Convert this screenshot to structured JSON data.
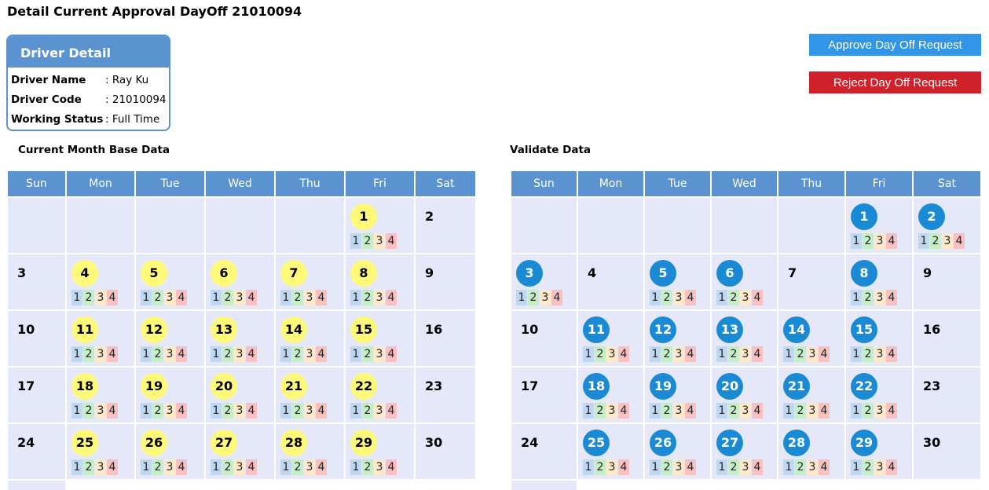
{
  "page": {
    "title": "Detail Current Approval DayOff 21010094"
  },
  "driver": {
    "header": "Driver Detail",
    "rows": [
      {
        "label": "Driver Name",
        "value": ": Ray Ku"
      },
      {
        "label": "Driver Code",
        "value": ": 21010094"
      },
      {
        "label": "Working Status",
        "value": ": Full Time"
      }
    ]
  },
  "actions": {
    "approve_label": "Approve Day Off Request",
    "reject_label": "Reject Day Off Request"
  },
  "colors": {
    "header_blue": "#5b93d0",
    "approve": "#3196e8",
    "reject": "#d0202a",
    "cell_bg": "#e4e8f8",
    "yellow_badge": "#fff97a",
    "blue_badge": "#1b8ad4"
  },
  "weekdays": [
    "Sun",
    "Mon",
    "Tue",
    "Wed",
    "Thu",
    "Fri",
    "Sat"
  ],
  "shift_labels": [
    "1",
    "2",
    "3",
    "4"
  ],
  "left_calendar": {
    "title": "Current Month Base Data",
    "highlight": "yellow",
    "weeks": [
      [
        null,
        null,
        null,
        null,
        null,
        {
          "d": "1",
          "h": true
        },
        {
          "d": "2",
          "h": false
        }
      ],
      [
        {
          "d": "3",
          "h": false
        },
        {
          "d": "4",
          "h": true
        },
        {
          "d": "5",
          "h": true
        },
        {
          "d": "6",
          "h": true
        },
        {
          "d": "7",
          "h": true
        },
        {
          "d": "8",
          "h": true
        },
        {
          "d": "9",
          "h": false
        }
      ],
      [
        {
          "d": "10",
          "h": false
        },
        {
          "d": "11",
          "h": true
        },
        {
          "d": "12",
          "h": true
        },
        {
          "d": "13",
          "h": true
        },
        {
          "d": "14",
          "h": true
        },
        {
          "d": "15",
          "h": true
        },
        {
          "d": "16",
          "h": false
        }
      ],
      [
        {
          "d": "17",
          "h": false
        },
        {
          "d": "18",
          "h": true
        },
        {
          "d": "19",
          "h": true
        },
        {
          "d": "20",
          "h": true
        },
        {
          "d": "21",
          "h": true
        },
        {
          "d": "22",
          "h": true
        },
        {
          "d": "23",
          "h": false
        }
      ],
      [
        {
          "d": "24",
          "h": false
        },
        {
          "d": "25",
          "h": true
        },
        {
          "d": "26",
          "h": true
        },
        {
          "d": "27",
          "h": true
        },
        {
          "d": "28",
          "h": true
        },
        {
          "d": "29",
          "h": true
        },
        {
          "d": "30",
          "h": false
        }
      ]
    ]
  },
  "right_calendar": {
    "title": "Validate Data",
    "highlight": "blue",
    "weeks": [
      [
        null,
        null,
        null,
        null,
        null,
        {
          "d": "1",
          "h": true
        },
        {
          "d": "2",
          "h": true
        }
      ],
      [
        {
          "d": "3",
          "h": true
        },
        {
          "d": "4",
          "h": false
        },
        {
          "d": "5",
          "h": true
        },
        {
          "d": "6",
          "h": true
        },
        {
          "d": "7",
          "h": false
        },
        {
          "d": "8",
          "h": true
        },
        {
          "d": "9",
          "h": false
        }
      ],
      [
        {
          "d": "10",
          "h": false
        },
        {
          "d": "11",
          "h": true
        },
        {
          "d": "12",
          "h": true
        },
        {
          "d": "13",
          "h": true
        },
        {
          "d": "14",
          "h": true
        },
        {
          "d": "15",
          "h": true
        },
        {
          "d": "16",
          "h": false
        }
      ],
      [
        {
          "d": "17",
          "h": false
        },
        {
          "d": "18",
          "h": true
        },
        {
          "d": "19",
          "h": true
        },
        {
          "d": "20",
          "h": true
        },
        {
          "d": "21",
          "h": true
        },
        {
          "d": "22",
          "h": true
        },
        {
          "d": "23",
          "h": false
        }
      ],
      [
        {
          "d": "24",
          "h": false
        },
        {
          "d": "25",
          "h": true
        },
        {
          "d": "26",
          "h": true
        },
        {
          "d": "27",
          "h": true
        },
        {
          "d": "28",
          "h": true
        },
        {
          "d": "29",
          "h": true
        },
        {
          "d": "30",
          "h": false
        }
      ]
    ]
  }
}
